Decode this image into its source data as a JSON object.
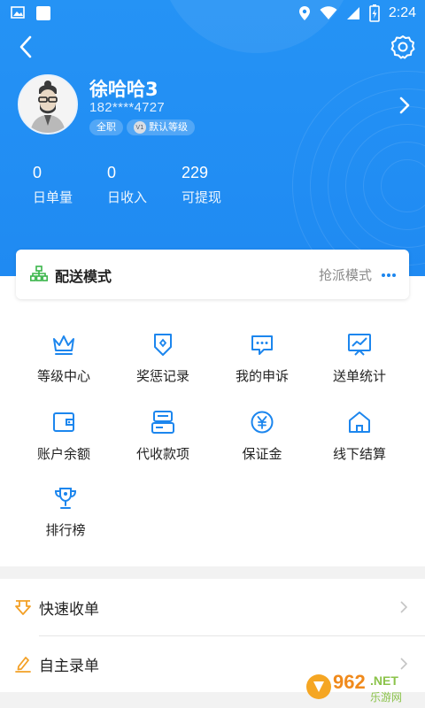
{
  "status_bar": {
    "time": "2:24"
  },
  "user": {
    "name": "徐哈哈3",
    "phone": "182****4727",
    "tags": [
      "全职",
      "默认等级"
    ],
    "level_badge": "V1"
  },
  "stats": [
    {
      "value": "0",
      "label": "日单量"
    },
    {
      "value": "0",
      "label": "日收入"
    },
    {
      "value": "229",
      "label": "可提现"
    }
  ],
  "delivery_mode": {
    "title": "配送模式",
    "value": "抢派模式"
  },
  "grid": [
    {
      "label": "等级中心",
      "icon": "crown-icon"
    },
    {
      "label": "奖惩记录",
      "icon": "badge-icon"
    },
    {
      "label": "我的申诉",
      "icon": "chat-icon"
    },
    {
      "label": "送单统计",
      "icon": "chart-icon"
    },
    {
      "label": "账户余额",
      "icon": "wallet-icon"
    },
    {
      "label": "代收款项",
      "icon": "payment-icon"
    },
    {
      "label": "保证金",
      "icon": "yen-icon"
    },
    {
      "label": "线下结算",
      "icon": "home-icon"
    },
    {
      "label": "排行榜",
      "icon": "trophy-icon"
    }
  ],
  "list": [
    {
      "label": "快速收单",
      "icon": "download-icon"
    },
    {
      "label": "自主录单",
      "icon": "edit-icon"
    }
  ],
  "watermark": {
    "brand": "962",
    "suffix": ".NET",
    "sub": "乐游网"
  },
  "colors": {
    "primary": "#1f8af2",
    "icon_blue": "#1c86ee",
    "orange": "#f3a026",
    "green": "#3ab54a"
  }
}
